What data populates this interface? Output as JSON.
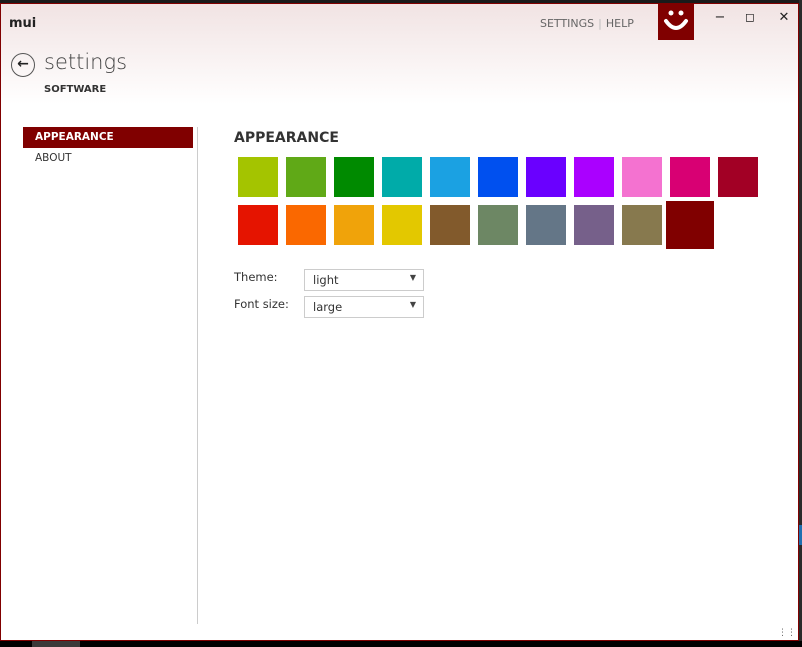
{
  "window": {
    "title": "mui",
    "links": [
      "SETTINGS",
      "HELP"
    ]
  },
  "header": {
    "title": "settings",
    "subtitle": "SOFTWARE"
  },
  "nav": [
    {
      "label": "APPEARANCE",
      "selected": true
    },
    {
      "label": "ABOUT",
      "selected": false
    }
  ],
  "appearance": {
    "heading": "APPEARANCE",
    "accent_colors": [
      "#a4c400",
      "#60a917",
      "#008a00",
      "#00aba9",
      "#1ba1e2",
      "#0050ef",
      "#6a00ff",
      "#aa00ff",
      "#f472d0",
      "#d80073",
      "#a20025",
      "#e51400",
      "#fa6800",
      "#f0a30a",
      "#e3c800",
      "#825a2c",
      "#6d8764",
      "#647687",
      "#76608a",
      "#87794e",
      "#800000"
    ],
    "selected_color": "#800000",
    "theme_label": "Theme:",
    "theme_value": "light",
    "font_label": "Font size:",
    "font_value": "large"
  }
}
